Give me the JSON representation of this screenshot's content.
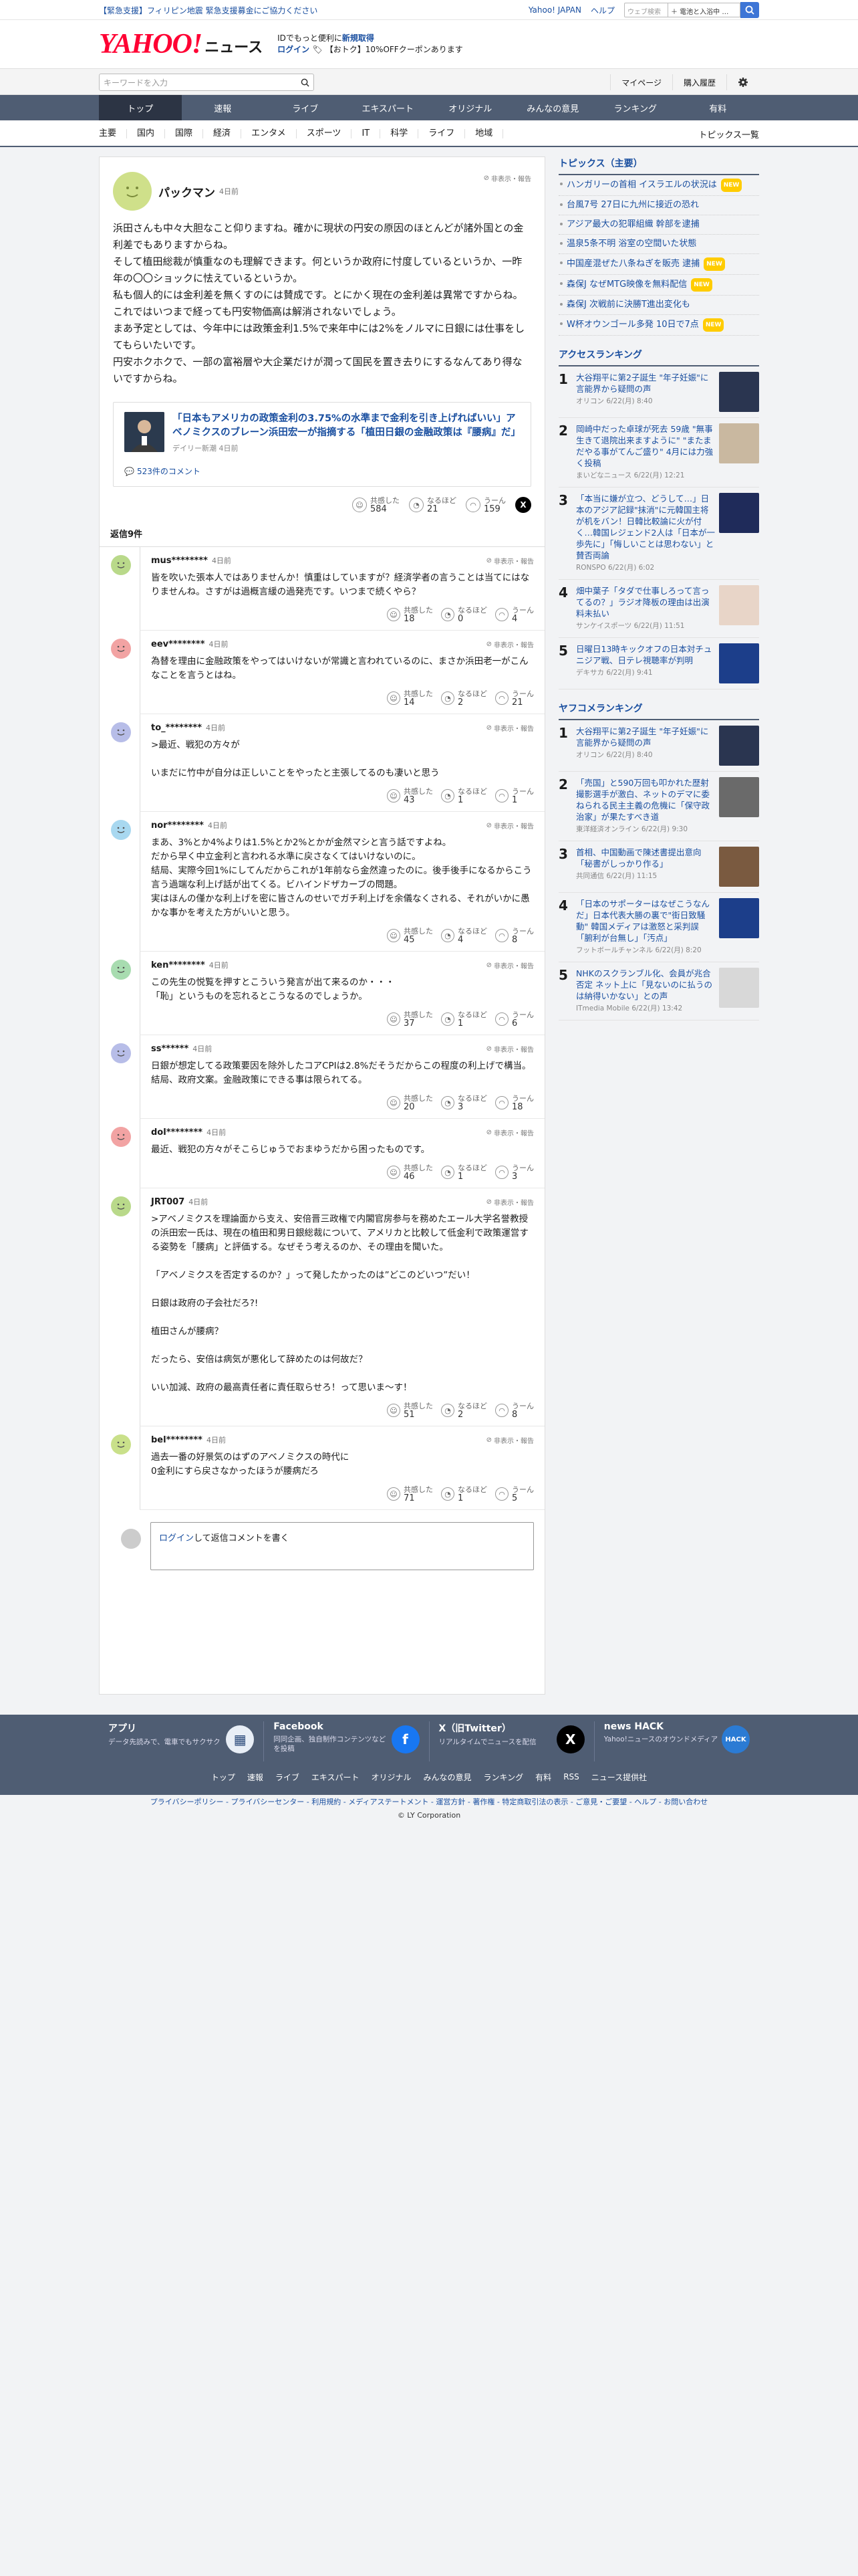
{
  "topbar": {
    "urgent": "【緊急支援】フィリピン地震 緊急支援募金にご協力ください",
    "links": [
      "Yahoo! JAPAN",
      "ヘルプ"
    ],
    "search_placeholder": "ウェブ検索",
    "search_scope": "＋ 電池と入浴中 …"
  },
  "header": {
    "logo_text": "YAHOO!",
    "logo_sub": "JAPAN",
    "logo_news": "ニュース",
    "promo_line1": "IDでもっと便利に",
    "promo_line1_bold": "新規取得",
    "login": "ログイン",
    "promo_line2": "【おトク】10%OFFクーポンあります"
  },
  "searchrow": {
    "placeholder": "キーワードを入力",
    "mypage": "マイページ",
    "history": "購入履歴"
  },
  "nav": [
    "トップ",
    "速報",
    "ライブ",
    "エキスパート",
    "オリジナル",
    "みんなの意見",
    "ランキング",
    "有料"
  ],
  "subnav": [
    "主要",
    "国内",
    "国際",
    "経済",
    "エンタメ",
    "スポーツ",
    "IT",
    "科学",
    "ライフ",
    "地域"
  ],
  "subnav_more": "トピックス一覧",
  "main_comment": {
    "name": "パックマン",
    "time": "4日前",
    "report": "非表示・報告",
    "body": [
      "浜田さんも中々大胆なこと仰りますね。確かに現状の円安の原因のほとんどが諸外国との金利差でもありますからね。",
      "そして植田総裁が慎重なのも理解できます。何というか政府に忖度しているというか、一昨年の〇〇ショックに怯えているというか。",
      "私も個人的には金利差を無くすのには賛成です。とにかく現在の金利差は異常ですからね。",
      "これではいつまで経っても円安物価高は解消されないでしょう。",
      "まあ予定としては、今年中には政策金利1.5%で来年中には2%をノルマに日銀には仕事をしてもらいたいです。",
      "円安ホクホクで、一部の富裕層や大企業だけが潤って国民を置き去りにするなんてあり得ないですからね。"
    ],
    "quote_title": "「日本もアメリカの政策金利の3.75%の水準まで金利を引き上げればいい」アベノミクスのブレーン浜田宏一が指摘する「植田日銀の金融政策は『腰病』だ」",
    "quote_source": "デイリー新潮 4日前",
    "quote_comments": "523件のコメント",
    "reactions": {
      "a_label": "共感した",
      "a": "584",
      "b_label": "なるほど",
      "b": "21",
      "c_label": "うーん",
      "c": "159"
    },
    "replies_label": "返信9件"
  },
  "replies": [
    {
      "name": "mus********",
      "time": "4日前",
      "color": "#b9d98a",
      "body": "皆を吹いた張本人ではありませんか！慎重はしていますが？経済学者の言うことは当てにはなりませんね。さすがは過概言緩の過発売です。いつまで続くやら？",
      "a": "18",
      "b": "0",
      "c": "4"
    },
    {
      "name": "eev********",
      "time": "4日前",
      "color": "#f2a3a3",
      "body": "為替を理由に金融政策をやってはいけないが常識と言われているのに、まさか浜田老一がこんなことを言うとはね。",
      "a": "14",
      "b": "2",
      "c": "21"
    },
    {
      "name": "to_********",
      "time": "4日前",
      "color": "#b7bde8",
      "body": ">最近、戦犯の方々が\n\nいまだに竹中が自分は正しいことをやったと主張してるのも凄いと思う",
      "a": "43",
      "b": "1",
      "c": "1"
    },
    {
      "name": "nor********",
      "time": "4日前",
      "color": "#a8d8f0",
      "body": "まあ、3%とか4%よりは1.5%とか2%とかが金然マシと言う話ですよね。\nだから早く中立金利と言われる水準に戻さなくてはいけないのに。\n結局、実際今回1%にしてんだからこれが1年前なら金然違ったのに。後手後手になるからこう言う過端な利上げ話が出てくる。ビハインドザカーブの問題。\n実はほんの僅かな利上げを密に皆さんのせいでガチ利上げを余儀なくされる、それがいかに愚かな事かを考えた方がいいと思う。",
      "a": "45",
      "b": "4",
      "c": "8"
    },
    {
      "name": "ken********",
      "time": "4日前",
      "color": "#a8dcb0",
      "body": "この先生の悦覧を押すとこういう発言が出て来るのか・・・\n「恥」というものを忘れるとこうなるのでしょうか。",
      "a": "37",
      "b": "1",
      "c": "6"
    },
    {
      "name": "ss******",
      "time": "4日前",
      "color": "#b7bde8",
      "body": "日銀が想定してる政策要因を除外したコアCPIは2.8%だそうだからこの程度の利上げで構当。結局、政府文案。金融政策にできる事は限られてる。",
      "a": "20",
      "b": "3",
      "c": "18"
    },
    {
      "name": "dol********",
      "time": "4日前",
      "color": "#f2a3a3",
      "body": "最近、戦犯の方々がそこらじゅうでおまゆうだから困ったものです。",
      "a": "46",
      "b": "1",
      "c": "3"
    },
    {
      "name": "JRT007",
      "time": "4日前",
      "color": "#b9d98a",
      "body": ">アベノミクスを理論面から支え、安倍晋三政権で内閣官房参与を務めたエール大学名誉教授の浜田宏一氏は、現在の植田和男日銀総裁について、アメリカと比較して低金利で政策運営する姿勢を「腰病」と評価する。なぜそう考えるのか、その理由を聞いた。\n\n「アベノミクスを否定するのか？」って発したかったのは”どこのどいつ”だい！\n\n日銀は政府の子会社だろ?!\n\n植田さんが腰病？\n\nだったら、安倍は病気が悪化して辞めたのは何故だ？\n\nいい加減、政府の最高責任者に責任取らせろ！って思いま〜す！",
      "a": "51",
      "b": "2",
      "c": "8"
    },
    {
      "name": "bel********",
      "time": "4日前",
      "color": "#c9e08a",
      "body": "過去一番の好景気のはずのアベノミクスの時代に\n0金利にすら戻さなかったほうが腰病だろ",
      "a": "71",
      "b": "1",
      "c": "5"
    }
  ],
  "reply_box": {
    "login": "ログイン",
    "text": "して返信コメントを書く"
  },
  "sidebar": {
    "topics_title": "トピックス（主要）",
    "topics": [
      {
        "t": "ハンガリーの首相 イスラエルの状況は",
        "new": true
      },
      {
        "t": "台風7号 27日に九州に接近の恐れ",
        "new": false
      },
      {
        "t": "アジア最大の犯罪組織 幹部を逮捕",
        "new": false
      },
      {
        "t": "温泉5条不明 浴室の空間いた状態",
        "new": false
      },
      {
        "t": "中国産混ぜた八条ねぎを販売 逮捕",
        "new": true
      },
      {
        "t": "森保J なぜMTG映像を無料配信",
        "new": true
      },
      {
        "t": "森保J 次戦前に決勝T進出変化も",
        "new": false
      },
      {
        "t": "W杯オウンゴール多発 10日で7点",
        "new": true
      }
    ],
    "access_title": "アクセスランキング",
    "access": [
      {
        "t": "大谷翔平に第2子誕生 \"年子妊娠\"に言能界から疑問の声",
        "s": "オリコン 6/22(月) 8:40",
        "c": "#2a3550"
      },
      {
        "t": "岡崎中だった卓球が死去 59歳 \"無事生きて退院出来ますように\" \"またまだやる事がてんご盛り\" 4月には力強く投稿",
        "s": "まいどなニュース 6/22(月) 12:21",
        "c": "#c9b8a0"
      },
      {
        "t": "「本当に嫌が立つ、どうして…」日本のアジア記録\"抹消\"に元韓国主将が机をバン！日韓比較論に火が付く…韓国レジェンド2人は「日本が一歩先に」「悔しいことは思わない」と賛否両論",
        "s": "RONSPO 6/22(月) 6:02",
        "c": "#1f2b5a"
      },
      {
        "t": "畑中葉子「タダで仕事しろって言ってるの？」ラジオ降板の理由は出演料未払い",
        "s": "サンケイスポーツ 6/22(月) 11:51",
        "c": "#e8d5c8"
      },
      {
        "t": "日曜日13時キックオフの日本対チュニジア戦、日テレ視聴率が判明",
        "s": "デキサカ 6/22(月) 9:41",
        "c": "#1c3e8a"
      }
    ],
    "yafuko_title": "ヤフコメランキング",
    "yafuko": [
      {
        "t": "大谷翔平に第2子誕生 \"年子妊娠\"に言能界から疑問の声",
        "s": "オリコン 6/22(月) 8:40",
        "c": "#2a3550"
      },
      {
        "t": "「売国」と590万回も叩かれた歴射撮影選手が激白、ネットのデマに委ねられる民主主義の危機に「保守政治家」が果たすべき道",
        "s": "東洋経済オンライン 6/22(月) 9:30",
        "c": "#6a6a6a"
      },
      {
        "t": "首相、中国動画で陳述書提出意向「秘書がしっかり作る」",
        "s": "共同通信 6/22(月) 11:15",
        "c": "#7a5a40"
      },
      {
        "t": "「日本のサポーターはなぜこうなんだ」日本代表大勝の裏で\"街日致騒動\" 韓国メディアは激怒と采判誤「腑利が台無し」「汚点」",
        "s": "フットボールチャンネル 6/22(月) 8:20",
        "c": "#1c3e8a"
      },
      {
        "t": "NHKのスクランブル化、会員が兆合否定 ネット上に「見ないのに払うのは納得いかない」との声",
        "s": "ITmedia Mobile 6/22(月) 13:42",
        "c": "#d8d8d8"
      }
    ]
  },
  "footer": {
    "promos": [
      {
        "t": "アプリ",
        "d": "データ先読みで、電車でもサクサク",
        "ic": "#e8eef6",
        "ig": "▦"
      },
      {
        "t": "Facebook",
        "d": "同同企画、独自制作コンテンツなどを投稿",
        "ic": "#1877f2",
        "ig": "f"
      },
      {
        "t": "X（旧Twitter）",
        "d": "リアルタイムでニュースを配信",
        "ic": "#000000",
        "ig": "X"
      },
      {
        "t": "news HACK",
        "d": "Yahoo!ニュースのオウンドメディア",
        "ic": "#2b7bd4",
        "ig": "HACK"
      }
    ],
    "links": [
      "トップ",
      "速報",
      "ライブ",
      "エキスパート",
      "オリジナル",
      "みんなの意見",
      "ランキング",
      "有料",
      "RSS",
      "ニュース提供社"
    ],
    "legal": "プライバシーポリシー - プライバシーセンター - 利用規約 - メディアステートメント - 運営方針 - 著作権 - 特定商取引法の表示 - ご意見・ご要望 - ヘルプ - お問い合わせ",
    "copyright": "© LY Corporation"
  }
}
